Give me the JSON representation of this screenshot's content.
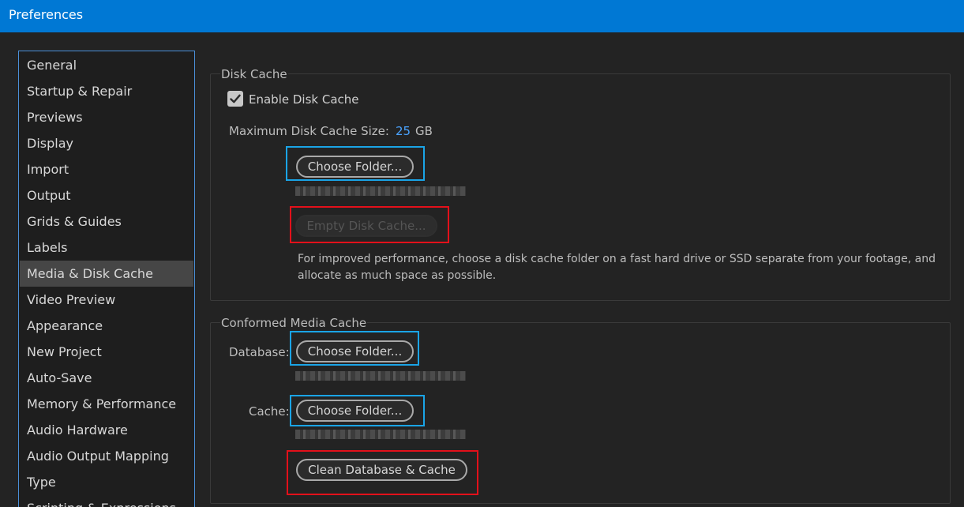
{
  "window": {
    "title": "Preferences"
  },
  "sidebar": {
    "items": [
      {
        "label": "General"
      },
      {
        "label": "Startup & Repair"
      },
      {
        "label": "Previews"
      },
      {
        "label": "Display"
      },
      {
        "label": "Import"
      },
      {
        "label": "Output"
      },
      {
        "label": "Grids & Guides"
      },
      {
        "label": "Labels"
      },
      {
        "label": "Media & Disk Cache",
        "selected": true
      },
      {
        "label": "Video Preview"
      },
      {
        "label": "Appearance"
      },
      {
        "label": "New Project"
      },
      {
        "label": "Auto-Save"
      },
      {
        "label": "Memory & Performance"
      },
      {
        "label": "Audio Hardware"
      },
      {
        "label": "Audio Output Mapping"
      },
      {
        "label": "Type"
      },
      {
        "label": "Scripting & Expressions"
      }
    ]
  },
  "disk_cache": {
    "group_label": "Disk Cache",
    "enable_label": "Enable Disk Cache",
    "enable_checked": true,
    "max_size_label": "Maximum Disk Cache Size:",
    "max_size_value": "25",
    "max_size_unit": "GB",
    "choose_folder_label": "Choose Folder...",
    "empty_cache_label": "Empty Disk Cache...",
    "help_text": "For improved performance, choose a disk cache folder on a fast hard drive or SSD separate from your footage, and allocate as much space as possible."
  },
  "conformed_media_cache": {
    "group_label": "Conformed Media Cache",
    "database_label": "Database:",
    "database_button_label": "Choose Folder...",
    "cache_label": "Cache:",
    "cache_button_label": "Choose Folder...",
    "clean_button_label": "Clean Database & Cache"
  },
  "colors": {
    "titlebar": "#0078d4",
    "highlight_blue": "#1aa4e6",
    "highlight_red": "#e3101a",
    "value_accent": "#4aa3ff"
  }
}
